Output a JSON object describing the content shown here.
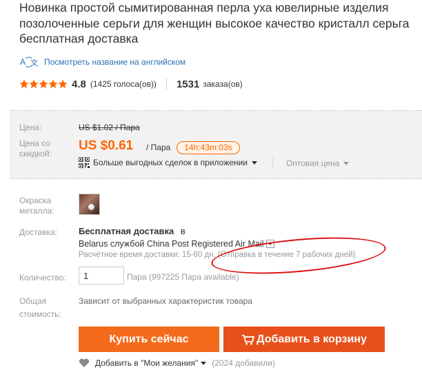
{
  "product": {
    "title": "Новинка простой сымитированная перла уха ювелирные изделия позолоченные серьги для женщин высокое качество кристалл серьга бесплатная доставка",
    "translate_link": "Посмотреть название на английском"
  },
  "rating": {
    "value": "4.8",
    "stars": 5,
    "votes": "(1425 голоса(ов))",
    "orders_count": "1531",
    "orders_label": "заказа(ов)"
  },
  "price": {
    "old_label": "Цена:",
    "old_price": "US $1.02 / Пара",
    "discount_label": "Цена со скидкой:",
    "new_price": "US $0.61",
    "unit": "/ Пара",
    "timer": "14h:43m:03s",
    "app_deals": "Больше выгодных сделок в приложении",
    "wholesale": "Оптовая цена"
  },
  "options": {
    "metal_label": "Окраска металла:"
  },
  "delivery": {
    "label": "Доставка:",
    "free": "Бесплатная доставка",
    "to": "в",
    "line2": "Belarus службой China Post Registered Air Mail",
    "time": "Расчётное время доставки: 15-60 дн. (Отправка в течение 7 рабочих дней)"
  },
  "quantity": {
    "label": "Количество:",
    "value": "1",
    "available": "Пара (997225 Пара available)"
  },
  "total": {
    "label": "Общая стоимость:",
    "text": "Зависит от выбранных характеристик товара"
  },
  "buttons": {
    "buy_now": "Купить сейчас",
    "add_to_cart": "Добавить в корзину"
  },
  "wishlist": {
    "label": "Добавить в \"Мои желания\"",
    "count": "(2024 добавили)"
  },
  "colors": {
    "accent": "#f60",
    "buy_button": "#f46a1b",
    "cart_button": "#e8501a",
    "link": "#2a6eb4",
    "annotation_circle": "#dd1111"
  },
  "icons": [
    "translate-icon",
    "star-icon",
    "qr-code-icon",
    "cart-icon",
    "heart-icon"
  ]
}
